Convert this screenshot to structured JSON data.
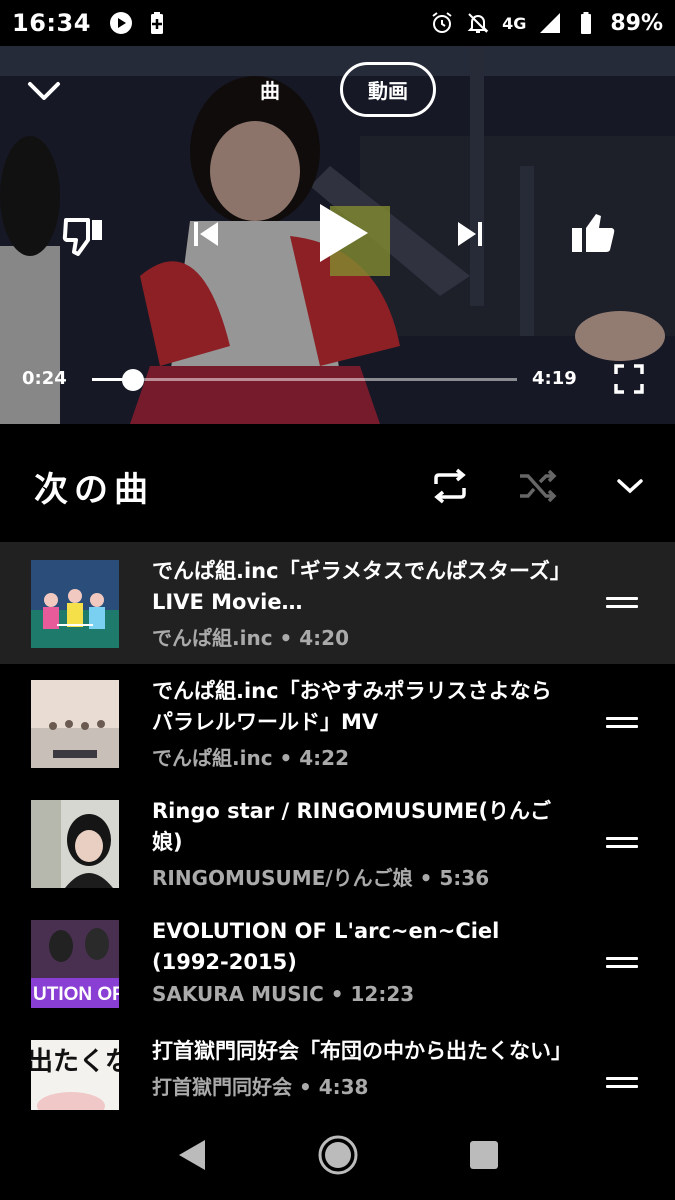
{
  "status_bar": {
    "time": "16:34",
    "network": "4G",
    "battery_pct": "89%"
  },
  "player": {
    "tabs": {
      "song": "曲",
      "video": "動画"
    },
    "active_tab": "video",
    "current_time": "0:24",
    "total_time": "4:19",
    "progress": 0.096
  },
  "up_next": {
    "title": "次の曲",
    "items": [
      {
        "title": "でんぱ組.inc「ギラメタスでんぱスターズ」LIVE Movie…",
        "subtitle": "でんぱ組.inc • 4:20",
        "active": true
      },
      {
        "title": "でんぱ組.inc「おやすみポラリスさよならパラレルワールド」MV",
        "subtitle": "でんぱ組.inc • 4:22",
        "active": false
      },
      {
        "title": "Ringo star / RINGOMUSUME(りんご娘)",
        "subtitle": "RINGOMUSUME/りんご娘 • 5:36",
        "active": false
      },
      {
        "title": "EVOLUTION OF L'arc~en~Ciel (1992-2015)",
        "subtitle": "SAKURA MUSIC • 12:23",
        "active": false
      },
      {
        "title": "打首獄門同好会「布団の中から出たくない」",
        "subtitle": "打首獄門同好会 • 4:38",
        "active": false
      }
    ]
  },
  "thumb_text": {
    "item4": "UTION OF",
    "item5": "出たくな"
  },
  "colors": {
    "background": "#000000",
    "active_row": "#212121",
    "subtitle": "#aaaaaa"
  }
}
